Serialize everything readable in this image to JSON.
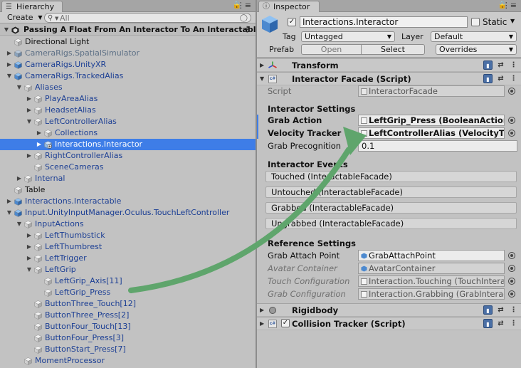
{
  "hierarchy": {
    "tab_label": "Hierarchy",
    "create_label": "Create",
    "search_placeholder": "All",
    "scene_name": "Passing A Float From An Interactor To An Interactable",
    "rows": [
      {
        "label": "Directional Light",
        "color": "black",
        "icon": "gray",
        "depth": 1,
        "fold": ""
      },
      {
        "label": "CameraRigs.SpatialSimulator",
        "color": "gray",
        "icon": "prefab-gray",
        "depth": 1,
        "fold": "closed"
      },
      {
        "label": "CameraRigs.UnityXR",
        "color": "blue",
        "icon": "prefab",
        "depth": 1,
        "fold": "closed"
      },
      {
        "label": "CameraRigs.TrackedAlias",
        "color": "blue",
        "icon": "prefab",
        "depth": 1,
        "fold": "open"
      },
      {
        "label": "Aliases",
        "color": "blue",
        "icon": "gray",
        "depth": 2,
        "fold": "open"
      },
      {
        "label": "PlayAreaAlias",
        "color": "blue",
        "icon": "gray",
        "depth": 3,
        "fold": "closed"
      },
      {
        "label": "HeadsetAlias",
        "color": "blue",
        "icon": "gray",
        "depth": 3,
        "fold": "closed"
      },
      {
        "label": "LeftControllerAlias",
        "color": "blue",
        "icon": "gray",
        "depth": 3,
        "fold": "open"
      },
      {
        "label": "Collections",
        "color": "blue",
        "icon": "gray",
        "depth": 4,
        "fold": "closed"
      },
      {
        "label": "Interactions.Interactor",
        "color": "blue",
        "icon": "prefab-add",
        "depth": 4,
        "fold": "closed",
        "selected": true
      },
      {
        "label": "RightControllerAlias",
        "color": "blue",
        "icon": "gray",
        "depth": 3,
        "fold": "closed"
      },
      {
        "label": "SceneCameras",
        "color": "blue",
        "icon": "gray",
        "depth": 3,
        "fold": ""
      },
      {
        "label": "Internal",
        "color": "blue",
        "icon": "gray",
        "depth": 2,
        "fold": "closed"
      },
      {
        "label": "Table",
        "color": "black",
        "icon": "gray",
        "depth": 1,
        "fold": ""
      },
      {
        "label": "Interactions.Interactable",
        "color": "blue",
        "icon": "prefab",
        "depth": 1,
        "fold": "closed"
      },
      {
        "label": "Input.UnityInputManager.Oculus.TouchLeftController",
        "color": "blue",
        "icon": "prefab",
        "depth": 1,
        "fold": "open"
      },
      {
        "label": "InputActions",
        "color": "blue",
        "icon": "gray",
        "depth": 2,
        "fold": "open"
      },
      {
        "label": "LeftThumbstick",
        "color": "blue",
        "icon": "gray",
        "depth": 3,
        "fold": "closed"
      },
      {
        "label": "LeftThumbrest",
        "color": "blue",
        "icon": "gray",
        "depth": 3,
        "fold": "closed"
      },
      {
        "label": "LeftTrigger",
        "color": "blue",
        "icon": "gray",
        "depth": 3,
        "fold": "closed"
      },
      {
        "label": "LeftGrip",
        "color": "blue",
        "icon": "gray",
        "depth": 3,
        "fold": "open"
      },
      {
        "label": "LeftGrip_Axis[11]",
        "color": "blue",
        "icon": "gray",
        "depth": 4,
        "fold": ""
      },
      {
        "label": "LeftGrip_Press",
        "color": "blue",
        "icon": "gray",
        "depth": 4,
        "fold": ""
      },
      {
        "label": "ButtonThree_Touch[12]",
        "color": "blue",
        "icon": "gray",
        "depth": 3,
        "fold": ""
      },
      {
        "label": "ButtonThree_Press[2]",
        "color": "blue",
        "icon": "gray",
        "depth": 3,
        "fold": ""
      },
      {
        "label": "ButtonFour_Touch[13]",
        "color": "blue",
        "icon": "gray",
        "depth": 3,
        "fold": ""
      },
      {
        "label": "ButtonFour_Press[3]",
        "color": "blue",
        "icon": "gray",
        "depth": 3,
        "fold": ""
      },
      {
        "label": "ButtonStart_Press[7]",
        "color": "blue",
        "icon": "gray",
        "depth": 3,
        "fold": ""
      },
      {
        "label": "MomentProcessor",
        "color": "blue",
        "icon": "gray",
        "depth": 2,
        "fold": ""
      }
    ]
  },
  "inspector": {
    "tab_label": "Inspector",
    "object_name": "Interactions.Interactor",
    "static_label": "Static",
    "tag_label": "Tag",
    "tag_value": "Untagged",
    "layer_label": "Layer",
    "layer_value": "Default",
    "prefab_label": "Prefab",
    "prefab_open": "Open",
    "prefab_select": "Select",
    "prefab_overrides": "Overrides",
    "transform_label": "Transform",
    "facade_label": "Interactor Facade (Script)",
    "script_label": "Script",
    "script_value": "InteractorFacade",
    "settings_header": "Interactor Settings",
    "grab_action_label": "Grab Action",
    "grab_action_value": "LeftGrip_Press (BooleanAction)",
    "velocity_tracker_label": "Velocity Tracker",
    "velocity_tracker_value": "LeftControllerAlias (VelocityTracker)",
    "grab_precognition_label": "Grab Precognition",
    "grab_precognition_value": "0.1",
    "events_header": "Interactor Events",
    "events": [
      "Touched (InteractableFacade)",
      "Untouched (InteractableFacade)",
      "Grabbed (InteractableFacade)",
      "Ungrabbed (InteractableFacade)"
    ],
    "reference_header": "Reference Settings",
    "grab_attach_label": "Grab Attach Point",
    "grab_attach_value": "GrabAttachPoint",
    "avatar_label": "Avatar Container",
    "avatar_value": "AvatarContainer",
    "touch_config_label": "Touch Configuration",
    "touch_config_value": "Interaction.Touching (TouchInteractorConfigurator)",
    "grab_config_label": "Grab Configuration",
    "grab_config_value": "Interaction.Grabbing (GrabInteractorConfigurator)",
    "rigidbody_label": "Rigidbody",
    "collision_label": "Collision Tracker (Script)"
  },
  "colors": {
    "selection": "#3e7de7",
    "prefab_text": "#1c3f94",
    "arrow": "#5fa56c"
  }
}
